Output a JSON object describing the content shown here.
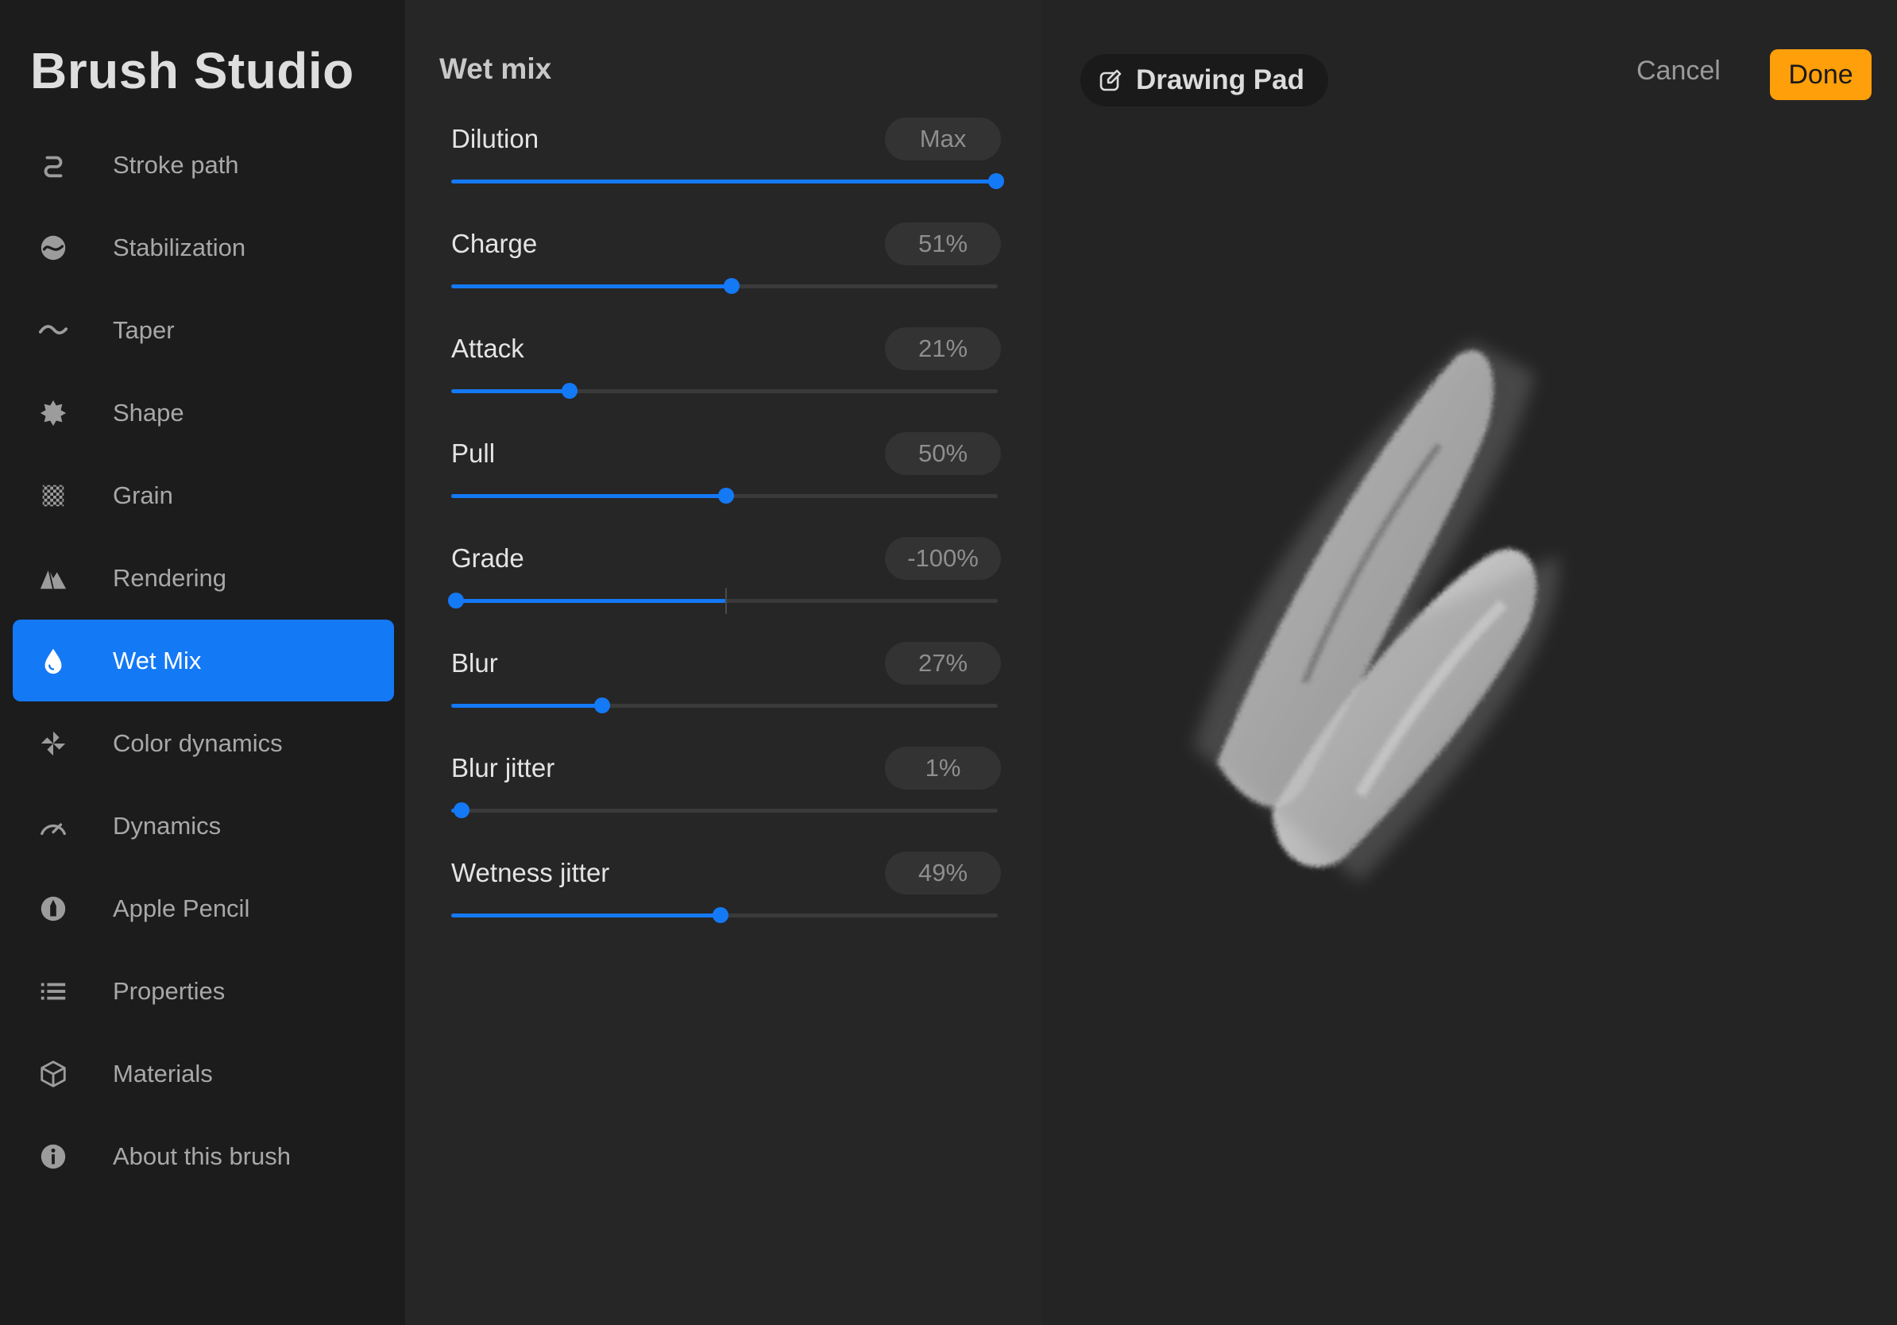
{
  "app": {
    "title": "Brush Studio"
  },
  "sidebar": {
    "items": [
      {
        "label": "Stroke path",
        "icon": "stroke-path-icon",
        "active": false
      },
      {
        "label": "Stabilization",
        "icon": "stabilization-icon",
        "active": false
      },
      {
        "label": "Taper",
        "icon": "taper-icon",
        "active": false
      },
      {
        "label": "Shape",
        "icon": "shape-icon",
        "active": false
      },
      {
        "label": "Grain",
        "icon": "grain-icon",
        "active": false
      },
      {
        "label": "Rendering",
        "icon": "rendering-icon",
        "active": false
      },
      {
        "label": "Wet Mix",
        "icon": "droplet-icon",
        "active": true
      },
      {
        "label": "Color dynamics",
        "icon": "pinwheel-icon",
        "active": false
      },
      {
        "label": "Dynamics",
        "icon": "gauge-icon",
        "active": false
      },
      {
        "label": "Apple Pencil",
        "icon": "pencil-icon",
        "active": false
      },
      {
        "label": "Properties",
        "icon": "list-icon",
        "active": false
      },
      {
        "label": "Materials",
        "icon": "cube-icon",
        "active": false
      },
      {
        "label": "About this brush",
        "icon": "info-icon",
        "active": false
      }
    ]
  },
  "panel": {
    "title": "Wet mix",
    "settings": [
      {
        "label": "Dilution",
        "value_text": "Max",
        "fraction": 1.0,
        "bipolar": false
      },
      {
        "label": "Charge",
        "value_text": "51%",
        "fraction": 0.51,
        "bipolar": false
      },
      {
        "label": "Attack",
        "value_text": "21%",
        "fraction": 0.21,
        "bipolar": false
      },
      {
        "label": "Pull",
        "value_text": "50%",
        "fraction": 0.5,
        "bipolar": false
      },
      {
        "label": "Grade",
        "value_text": "-100%",
        "fraction": 0.0,
        "bipolar": true
      },
      {
        "label": "Blur",
        "value_text": "27%",
        "fraction": 0.27,
        "bipolar": false
      },
      {
        "label": "Blur jitter",
        "value_text": "1%",
        "fraction": 0.01,
        "bipolar": false
      },
      {
        "label": "Wetness jitter",
        "value_text": "49%",
        "fraction": 0.49,
        "bipolar": false
      }
    ]
  },
  "pad": {
    "title": "Drawing Pad",
    "cancel_label": "Cancel",
    "done_label": "Done"
  },
  "colors": {
    "accent": "#1479f5",
    "done": "#ff9f0a",
    "sidebar_bg": "#1c1c1c",
    "panel_bg": "#262626",
    "pad_bg": "#242424"
  }
}
